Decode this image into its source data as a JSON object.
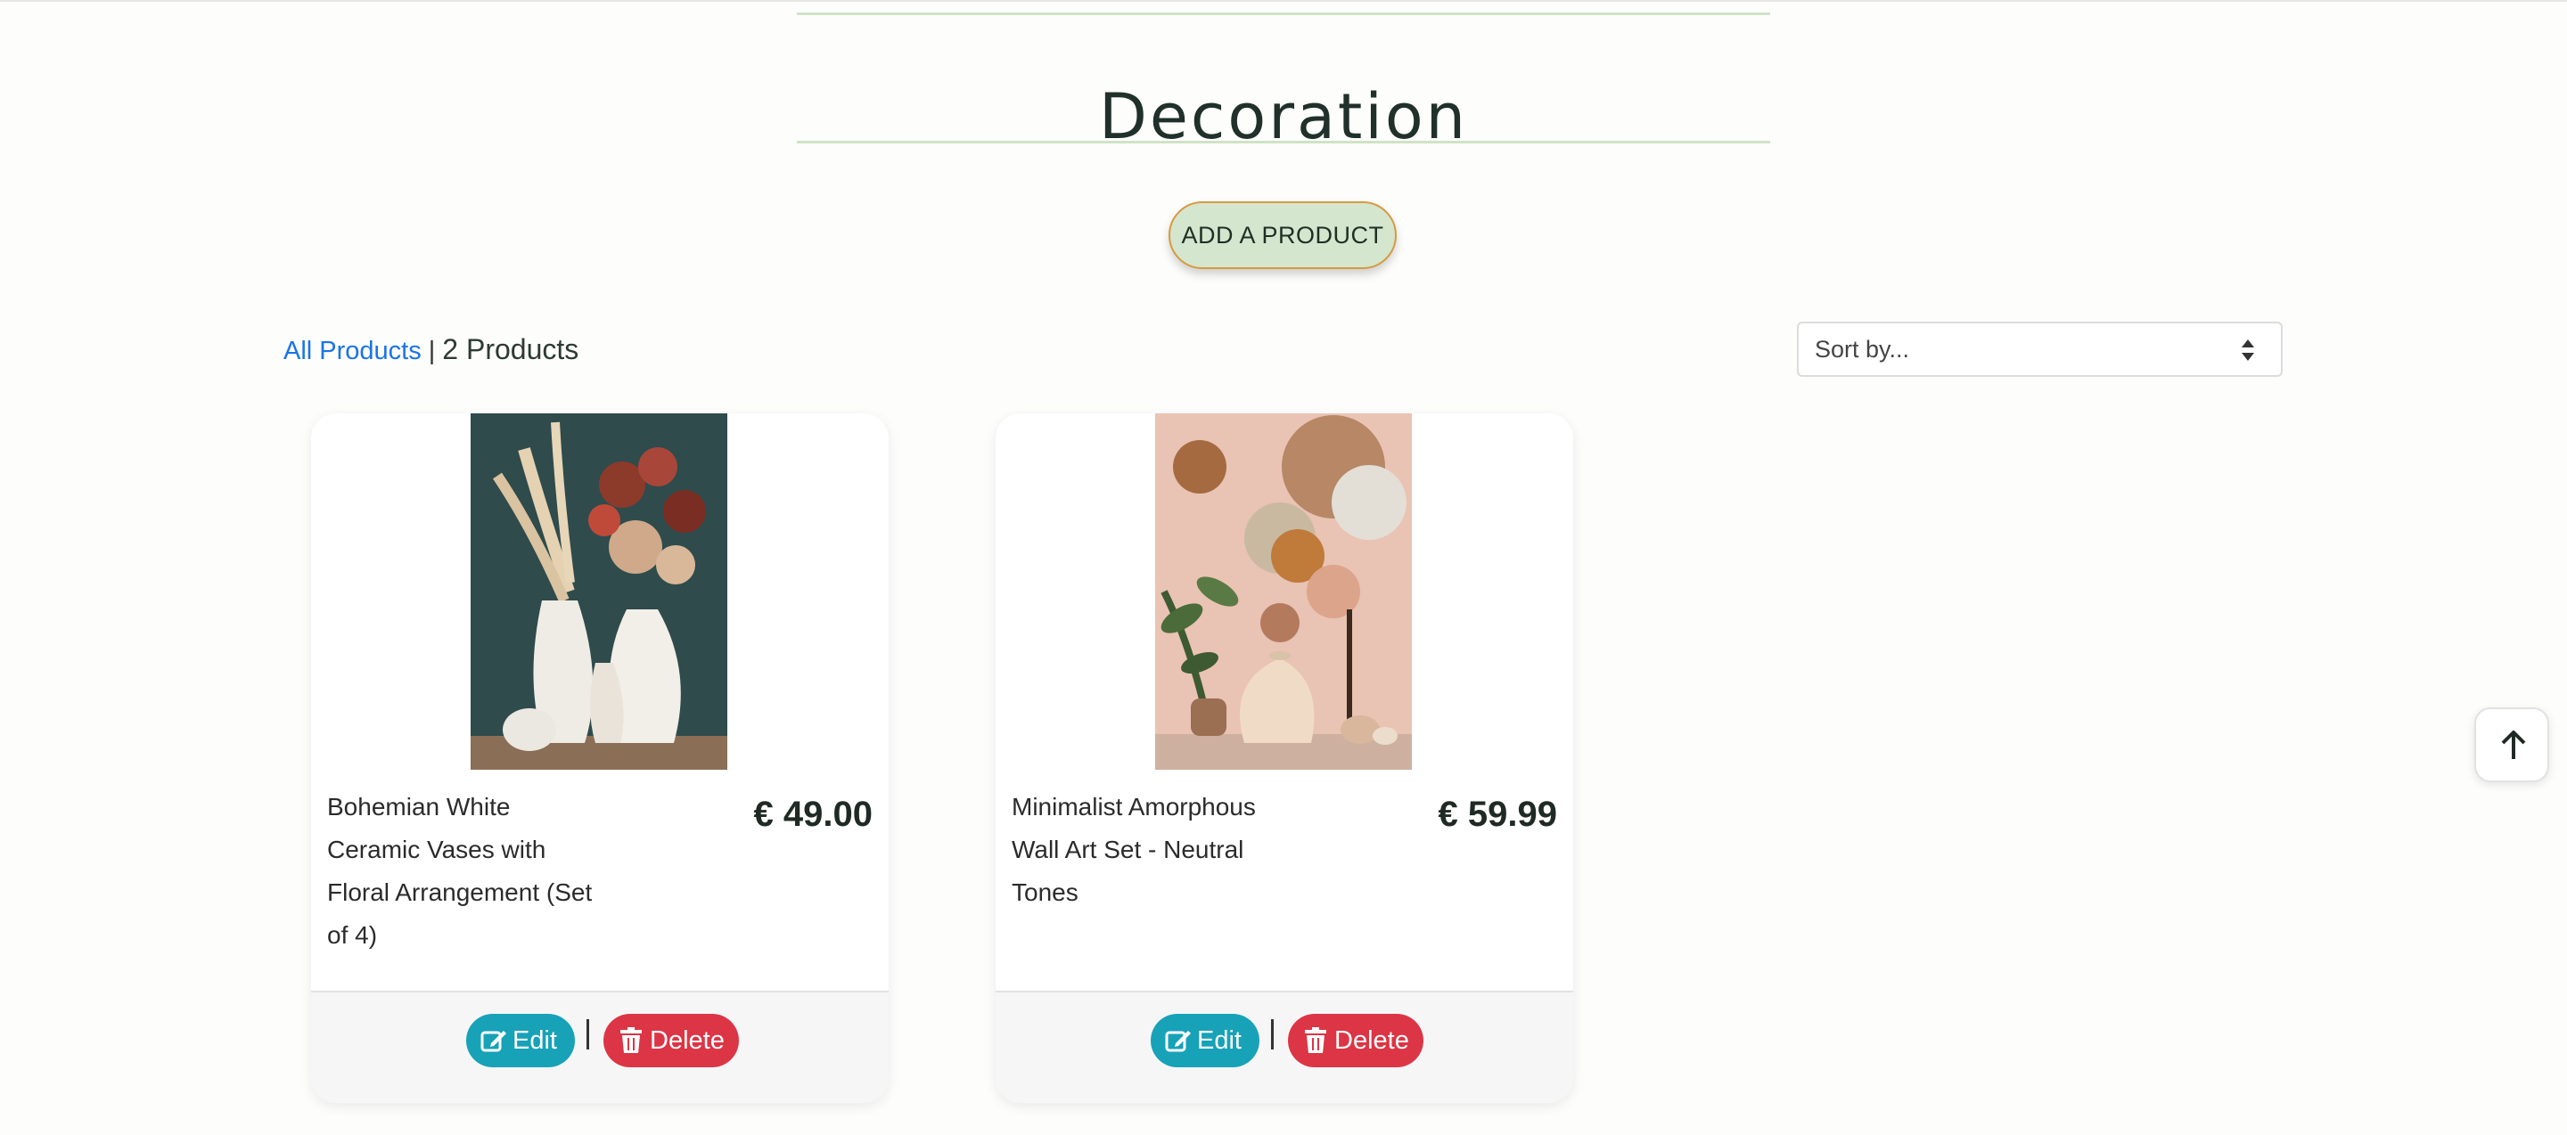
{
  "page": {
    "title": "Decoration"
  },
  "actions": {
    "add_product_label": "ADD A PRODUCT"
  },
  "breadcrumb": {
    "all_products": "All Products",
    "separator": "|",
    "count": "2 Products"
  },
  "sort": {
    "placeholder": "Sort by..."
  },
  "products": [
    {
      "name": "Bohemian White Ceramic Vases with Floral Arrangement (Set of 4)",
      "price": "€ 49.00",
      "edit_label": "Edit",
      "delete_label": "Delete",
      "separator": "|"
    },
    {
      "name": "Minimalist Amorphous Wall Art Set - Neutral Tones",
      "price": "€ 59.99",
      "edit_label": "Edit",
      "delete_label": "Delete",
      "separator": "|"
    }
  ],
  "colors": {
    "edit": "#17a2b8",
    "delete": "#dc3545",
    "accent": "#d5e6cf",
    "link": "#1a73e8"
  },
  "icons": {
    "edit": "edit-icon",
    "delete": "trash-icon",
    "scroll_top": "arrow-up-icon",
    "sort": "sort-caret-icon"
  }
}
